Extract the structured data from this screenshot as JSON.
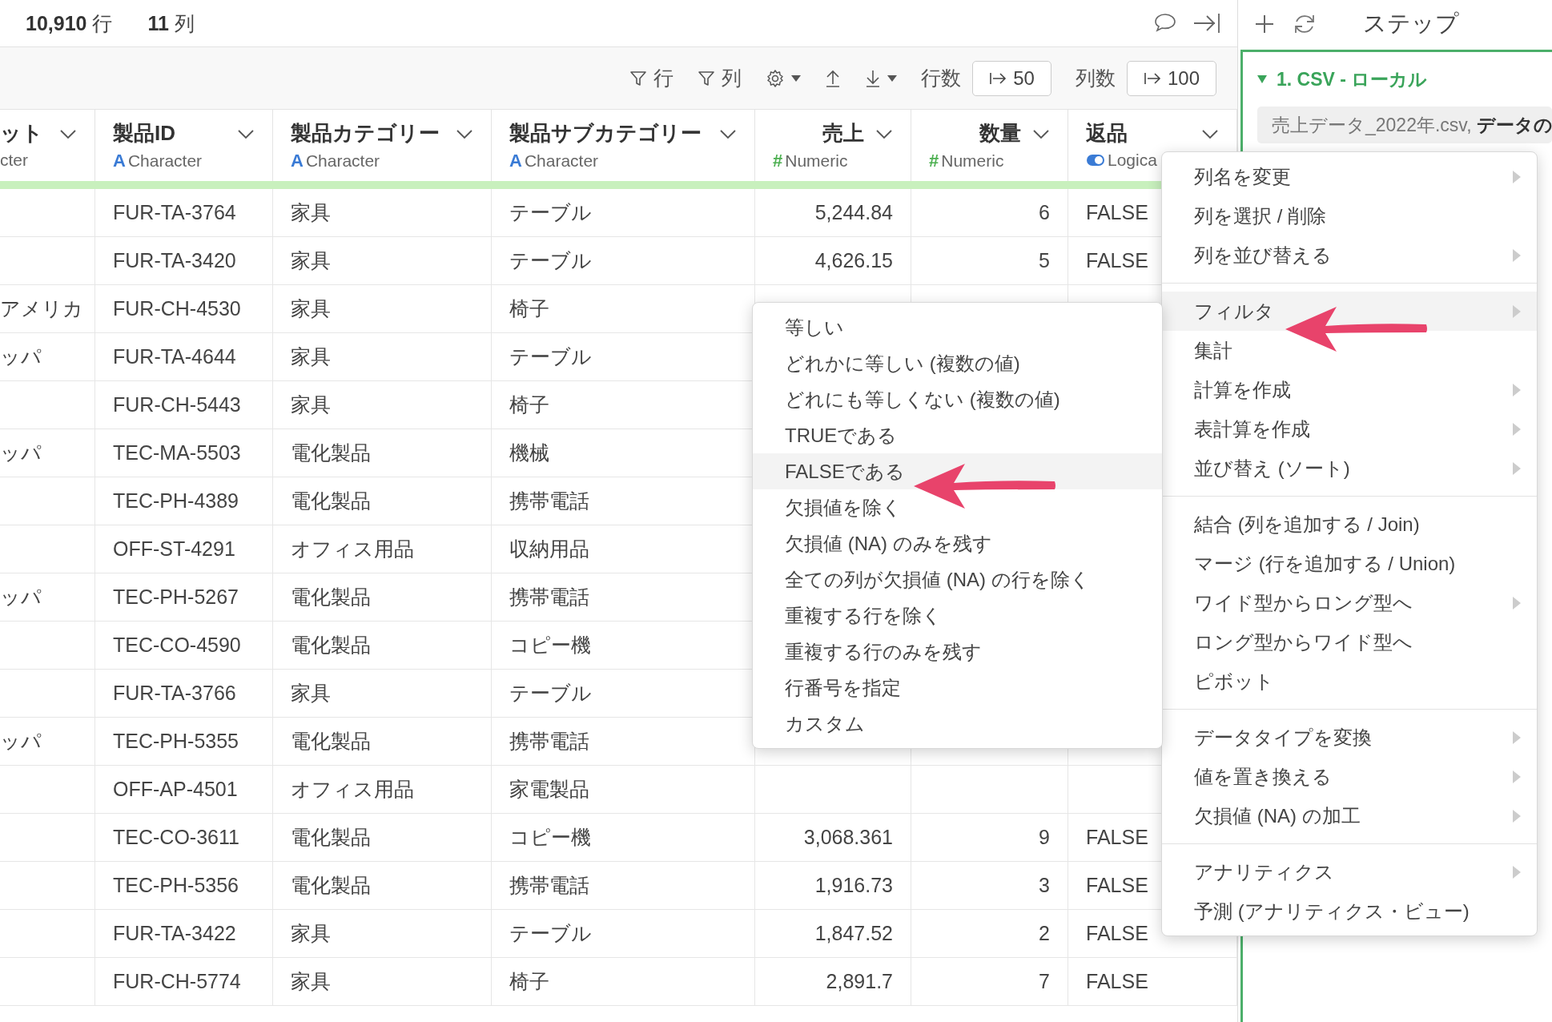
{
  "summary": {
    "rows": "**10,910** 行",
    "columns": "**11** 列"
  },
  "toolbar": {
    "row_filter": "行",
    "column_filter": "列",
    "rows_label": "行数",
    "rows_value": "50",
    "columns_label": "列数",
    "columns_value": "100"
  },
  "steps_panel": {
    "title": "ステップ",
    "step": {
      "label": "1. CSV - ローカル",
      "expanded": true,
      "detail": "売上データ_2022年.csv, **データの**"
    }
  },
  "table": {
    "columns": [
      {
        "name": "ット",
        "type": "cter",
        "kind": "cut"
      },
      {
        "name": "製品ID",
        "type": "Character",
        "kind": "character",
        "icon": "A"
      },
      {
        "name": "製品カテゴリー",
        "type": "Character",
        "kind": "character",
        "icon": "A"
      },
      {
        "name": "製品サブカテゴリー",
        "type": "Character",
        "kind": "character",
        "icon": "A"
      },
      {
        "name": "売上",
        "type": "Numeric",
        "kind": "numeric",
        "icon": "#"
      },
      {
        "name": "数量",
        "type": "Numeric",
        "kind": "numeric",
        "icon": "#"
      },
      {
        "name": "返品",
        "type": "Logica",
        "kind": "logical"
      }
    ],
    "rows": [
      [
        null,
        "FUR-TA-3764",
        "家具",
        "テーブル",
        "5,244.84",
        "6",
        "FALSE"
      ],
      [
        null,
        "FUR-TA-3420",
        "家具",
        "テーブル",
        "4,626.15",
        "5",
        "FALSE"
      ],
      [
        "アメリカ",
        "FUR-CH-4530",
        "家具",
        "椅子",
        null,
        null,
        null
      ],
      [
        "ッパ",
        "FUR-TA-4644",
        "家具",
        "テーブル",
        null,
        null,
        null
      ],
      [
        null,
        "FUR-CH-5443",
        "家具",
        "椅子",
        null,
        null,
        null
      ],
      [
        "ッパ",
        "TEC-MA-5503",
        "電化製品",
        "機械",
        null,
        null,
        null
      ],
      [
        null,
        "TEC-PH-4389",
        "電化製品",
        "携帯電話",
        null,
        null,
        null
      ],
      [
        null,
        "OFF-ST-4291",
        "オフィス用品",
        "収納用品",
        null,
        null,
        null
      ],
      [
        "ッパ",
        "TEC-PH-5267",
        "電化製品",
        "携帯電話",
        null,
        null,
        null
      ],
      [
        null,
        "TEC-CO-4590",
        "電化製品",
        "コピー機",
        null,
        null,
        null
      ],
      [
        null,
        "FUR-TA-3766",
        "家具",
        "テーブル",
        null,
        null,
        null
      ],
      [
        "ッパ",
        "TEC-PH-5355",
        "電化製品",
        "携帯電話",
        null,
        null,
        null
      ],
      [
        null,
        "OFF-AP-4501",
        "オフィス用品",
        "家電製品",
        null,
        null,
        null
      ],
      [
        null,
        "TEC-CO-3611",
        "電化製品",
        "コピー機",
        "3,068.361",
        "9",
        "FALSE"
      ],
      [
        null,
        "TEC-PH-5356",
        "電化製品",
        "携帯電話",
        "1,916.73",
        "3",
        "FALSE"
      ],
      [
        null,
        "FUR-TA-3422",
        "家具",
        "テーブル",
        "1,847.52",
        "2",
        "FALSE"
      ],
      [
        null,
        "FUR-CH-5774",
        "家具",
        "椅子",
        "2,891.7",
        "7",
        "FALSE"
      ]
    ]
  },
  "column_menu": {
    "sections": [
      {
        "items": [
          {
            "label": "列名を変更",
            "submenu": true,
            "selected": false
          },
          {
            "label": "列を選択 / 削除",
            "submenu": false,
            "selected": false
          },
          {
            "label": "列を並び替える",
            "submenu": true,
            "selected": false
          }
        ]
      },
      {
        "items": [
          {
            "label": "フィルタ",
            "submenu": true,
            "selected": true
          },
          {
            "label": "集計",
            "submenu": false,
            "selected": false
          },
          {
            "label": "計算を作成",
            "submenu": true,
            "selected": false
          },
          {
            "label": "表計算を作成",
            "submenu": true,
            "selected": false
          },
          {
            "label": "並び替え (ソート)",
            "submenu": true,
            "selected": false
          }
        ]
      },
      {
        "items": [
          {
            "label": "結合 (列を追加する / Join)",
            "submenu": false,
            "selected": false
          },
          {
            "label": "マージ (行を追加する / Union)",
            "submenu": false,
            "selected": false
          },
          {
            "label": "ワイド型からロング型へ",
            "submenu": true,
            "selected": false
          },
          {
            "label": "ロング型からワイド型へ",
            "submenu": false,
            "selected": false
          },
          {
            "label": "ピボット",
            "submenu": false,
            "selected": false
          }
        ]
      },
      {
        "items": [
          {
            "label": "データタイプを変換",
            "submenu": true,
            "selected": false
          },
          {
            "label": "値を置き換える",
            "submenu": true,
            "selected": false
          },
          {
            "label": "欠損値 (NA) の加工",
            "submenu": true,
            "selected": false
          }
        ]
      },
      {
        "items": [
          {
            "label": "アナリティクス",
            "submenu": true,
            "selected": false
          },
          {
            "label": "予測 (アナリティクス・ビュー)",
            "submenu": false,
            "selected": false
          }
        ]
      }
    ]
  },
  "filter_menu": {
    "sections": [
      {
        "items": [
          {
            "label": "等しい",
            "selected": false
          },
          {
            "label": "どれかに等しい (複数の値)",
            "selected": false
          },
          {
            "label": "どれにも等しくない (複数の値)",
            "selected": false
          },
          {
            "label": "TRUEである",
            "selected": false
          },
          {
            "label": "FALSEである",
            "selected": true
          },
          {
            "label": "欠損値を除く",
            "selected": false
          },
          {
            "label": "欠損値 (NA) のみを残す",
            "selected": false
          },
          {
            "label": "全ての列が欠損値 (NA) の行を除く",
            "selected": false
          },
          {
            "label": "重複する行を除く",
            "selected": false
          },
          {
            "label": "重複する行のみを残す",
            "selected": false
          },
          {
            "label": "行番号を指定",
            "selected": false
          },
          {
            "label": "カスタム",
            "selected": false
          }
        ]
      }
    ]
  }
}
